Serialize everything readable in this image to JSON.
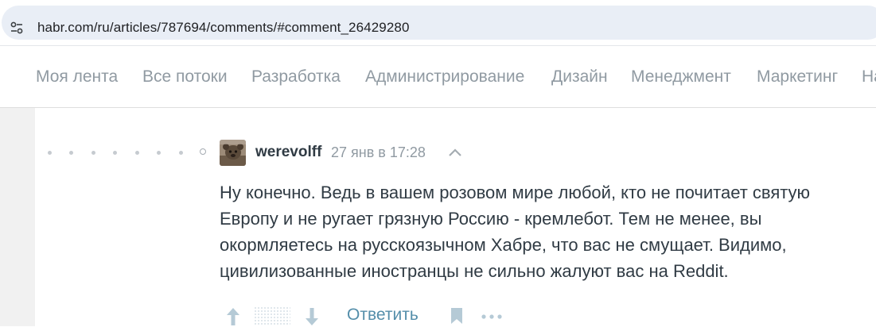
{
  "browser": {
    "url": "habr.com/ru/articles/787694/comments/#comment_26429280"
  },
  "hubs": [
    "Моя лента",
    "Все потоки",
    "Разработка",
    "Администрирование",
    "Дизайн",
    "Менеджмент",
    "Маркетинг",
    "На"
  ],
  "comment": {
    "author": "werevolff",
    "timestamp": "27 янв в 17:28",
    "lines": [
      "Ну конечно. Ведь в вашем розовом мире любой, кто не почитает святую",
      "Европу и не ругает грязную Россию - кремлебот. Тем не менее, вы",
      "окормляетесь на русскоязычном Хабре, что вас не смущает. Видимо,",
      "цивилизованные иностранцы не сильно жалуют вас на Reddit."
    ],
    "reply_label": "Ответить"
  },
  "colors": {
    "accent": "#548eaa",
    "muted": "#909aa2",
    "text": "#303b44"
  },
  "icons": {
    "site_settings": "tune-icon",
    "collapse": "chevron-up-icon",
    "upvote": "arrow-up-icon",
    "downvote": "arrow-down-icon",
    "bookmark": "bookmark-icon",
    "more": "more-icon"
  }
}
